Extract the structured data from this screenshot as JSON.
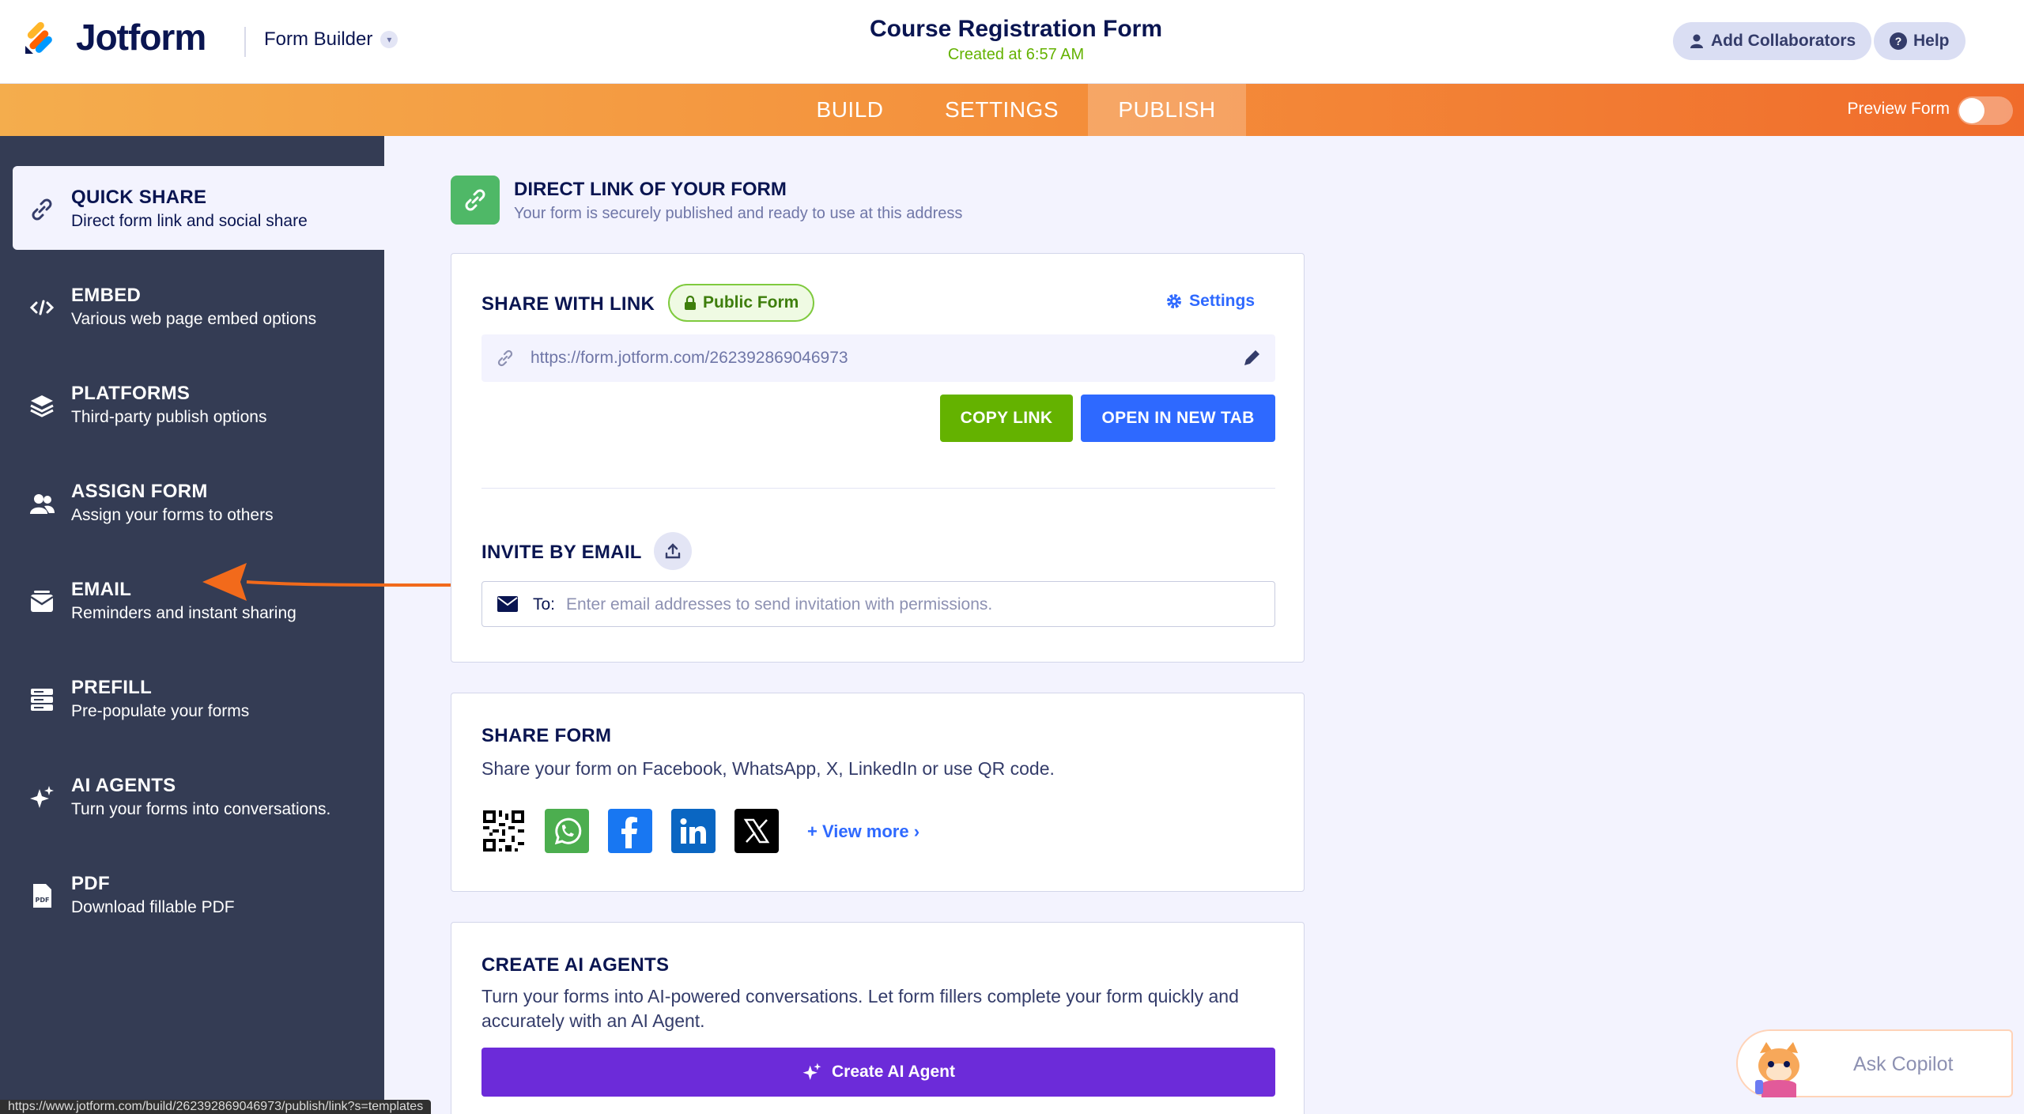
{
  "header": {
    "brand": "Jotform",
    "form_builder": "Form Builder",
    "title": "Course Registration Form",
    "created": "Created at 6:57 AM",
    "add_collaborators": "Add Collaborators",
    "help": "Help"
  },
  "nav": {
    "tabs": [
      {
        "label": "BUILD",
        "active": false
      },
      {
        "label": "SETTINGS",
        "active": false
      },
      {
        "label": "PUBLISH",
        "active": true
      }
    ],
    "preview_label": "Preview Form",
    "preview_on": false
  },
  "sidebar": {
    "items": [
      {
        "title": "QUICK SHARE",
        "desc": "Direct form link and social share",
        "icon": "link-icon",
        "active": true
      },
      {
        "title": "EMBED",
        "desc": "Various web page embed options",
        "icon": "code-icon",
        "active": false
      },
      {
        "title": "PLATFORMS",
        "desc": "Third-party publish options",
        "icon": "layers-icon",
        "active": false
      },
      {
        "title": "ASSIGN FORM",
        "desc": "Assign your forms to others",
        "icon": "users-icon",
        "active": false
      },
      {
        "title": "EMAIL",
        "desc": "Reminders and instant sharing",
        "icon": "email-inbox-icon",
        "active": false
      },
      {
        "title": "PREFILL",
        "desc": "Pre-populate your forms",
        "icon": "prefill-icon",
        "active": false
      },
      {
        "title": "AI AGENTS",
        "desc": "Turn your forms into conversations.",
        "icon": "sparkle-icon",
        "active": false
      },
      {
        "title": "PDF",
        "desc": "Download fillable PDF",
        "icon": "pdf-icon",
        "active": false
      }
    ]
  },
  "main": {
    "section_title": "DIRECT LINK OF YOUR FORM",
    "section_sub": "Your form is securely published and ready to use at this address",
    "share_link": {
      "title": "SHARE WITH LINK",
      "badge": "Public Form",
      "settings": "Settings",
      "url": "https://form.jotform.com/262392869046973",
      "copy_label": "COPY LINK",
      "open_label": "OPEN IN NEW TAB"
    },
    "invite": {
      "title": "INVITE BY EMAIL",
      "to_label": "To:",
      "placeholder": "Enter email addresses to send invitation with permissions."
    },
    "share_form": {
      "title": "SHARE FORM",
      "desc": "Share your form on Facebook, WhatsApp, X, LinkedIn or use QR code.",
      "view_more": "+ View more ›"
    },
    "ai_agents": {
      "title": "CREATE AI AGENTS",
      "desc": "Turn your forms into AI-powered conversations. Let form fillers complete your form quickly and accurately with an AI Agent.",
      "button": "Create AI Agent"
    }
  },
  "copilot": {
    "label": "Ask Copilot"
  },
  "status_url": "https://www.jotform.com/build/262392869046973/publish/link?s=templates",
  "colors": {
    "accent_orange": "#f48d3a",
    "sidebar_bg": "#343c54",
    "copy_green": "#64b200",
    "open_blue": "#2e69ff",
    "ai_purple": "#6c2bd9"
  }
}
